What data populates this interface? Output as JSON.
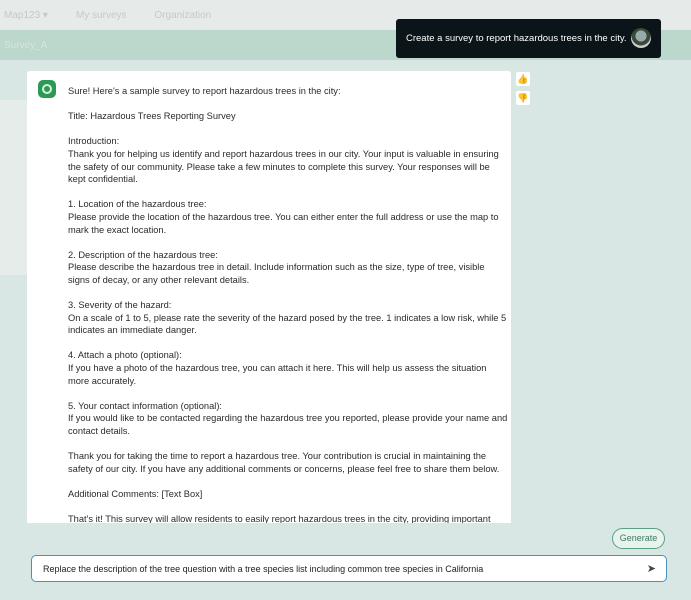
{
  "topbar": {
    "items": [
      "Map123 ▾",
      "My surveys",
      "Organization"
    ]
  },
  "band": {
    "title": "Survey_A"
  },
  "user_message": "Create a survey to report hazardous trees in the city.",
  "bot_message": [
    "Sure! Here's a sample survey to report hazardous trees in the city:",
    "Title: Hazardous Trees Reporting Survey",
    "Introduction:\nThank you for helping us identify and report hazardous trees in our city. Your input is valuable in ensuring the safety of our community. Please take a few minutes to complete this survey. Your responses will be kept confidential.",
    "1. Location of the hazardous tree:\nPlease provide the location of the hazardous tree. You can either enter the full address or use the map to mark the exact location.",
    "2. Description of the hazardous tree:\nPlease describe the hazardous tree in detail. Include information such as the size, type of tree, visible signs of decay, or any other relevant details.",
    "3. Severity of the hazard:\nOn a scale of 1 to 5, please rate the severity of the hazard posed by the tree. 1 indicates a low risk, while 5 indicates an immediate danger.",
    "4. Attach a photo (optional):\nIf you have a photo of the hazardous tree, you can attach it here. This will help us assess the situation more accurately.",
    "5. Your contact information (optional):\nIf you would like to be contacted regarding the hazardous tree you reported, please provide your name and contact details.",
    "Thank you for taking the time to report a hazardous tree. Your contribution is crucial in maintaining the safety of our city. If you have any additional comments or concerns, please feel free to share them below.",
    "Additional Comments: [Text Box]",
    "That's it! This survey will allow residents to easily report hazardous trees in the city, providing important"
  ],
  "generate_label": "Generate",
  "input": {
    "value": "Replace the description of the tree question with a tree species list including common tree species in California"
  }
}
